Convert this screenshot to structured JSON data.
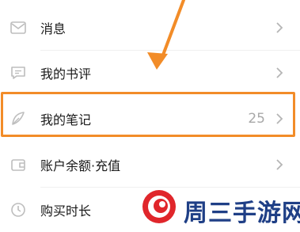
{
  "menu": {
    "items": [
      {
        "label": "消息",
        "icon": "mail-icon"
      },
      {
        "label": "我的书评",
        "icon": "comment-icon"
      },
      {
        "label": "我的笔记",
        "icon": "feather-icon",
        "count": "25"
      },
      {
        "label": "账户余额·充值",
        "icon": "wallet-icon"
      },
      {
        "label": "购买时长",
        "icon": "clock-icon"
      }
    ]
  },
  "watermark": {
    "text": "周三手游网"
  },
  "colors": {
    "highlight": "#f28c28",
    "icon": "#bdbdbd",
    "watermark_red": "#e0262b",
    "watermark_blue": "#1f3f86"
  }
}
